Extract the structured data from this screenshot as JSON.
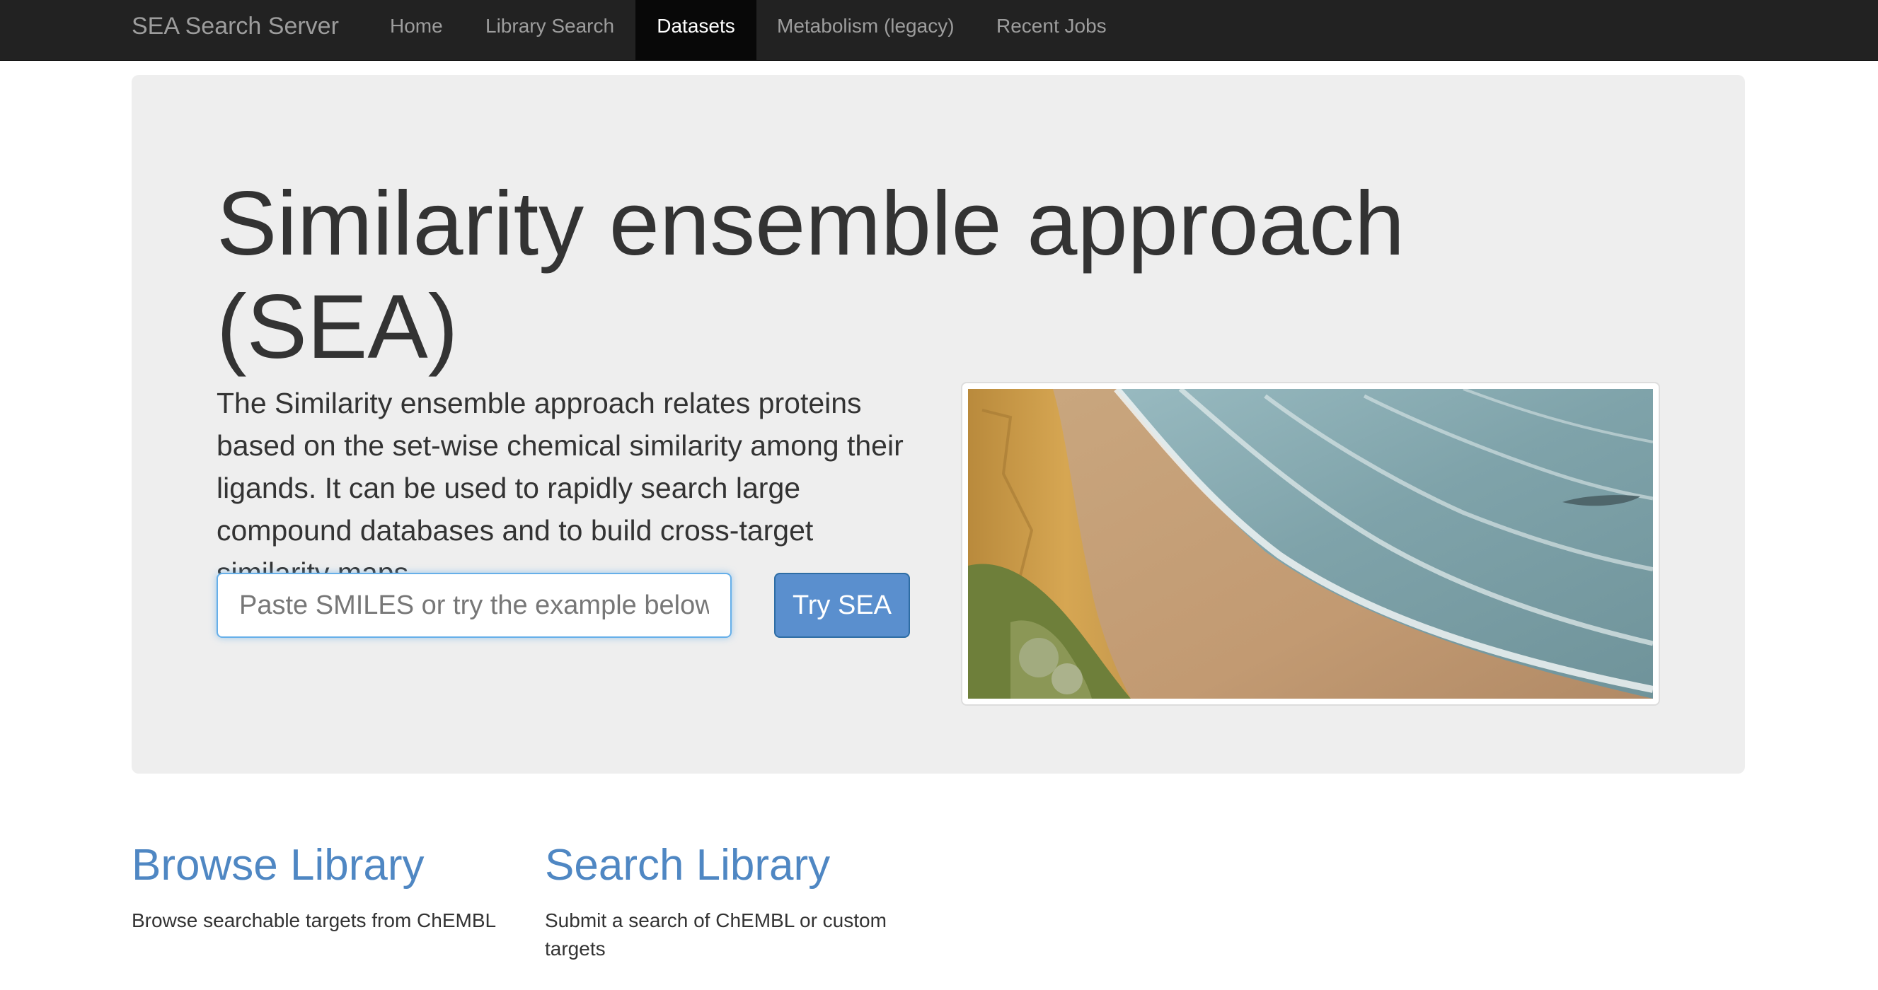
{
  "navbar": {
    "brand": "SEA Search Server",
    "items": [
      {
        "label": "Home"
      },
      {
        "label": "Library Search"
      },
      {
        "label": "Datasets",
        "active": true
      },
      {
        "label": "Metabolism (legacy)"
      },
      {
        "label": "Recent Jobs"
      }
    ]
  },
  "jumbotron": {
    "title": "Similarity ensemble approach (SEA)",
    "lead": "The Similarity ensemble approach relates proteins based on the set-wise chemical similarity among their ligands. It can be used to rapidly search large compound databases and to build cross-target similarity maps.",
    "input_placeholder": "Paste SMILES or try the example below",
    "input_value": "",
    "button_label": "Try SEA",
    "image_subject": "coastal cliff and beach"
  },
  "features": [
    {
      "title": "Browse Library",
      "description": "Browse searchable targets from ChEMBL"
    },
    {
      "title": "Search Library",
      "description": "Submit a search of ChEMBL or custom targets"
    }
  ],
  "colors": {
    "navbar_bg": "#222222",
    "nav_active_bg": "#080808",
    "jumbotron_bg": "#eeeeee",
    "link": "#4f87c3",
    "primary_button": "#5a8fce"
  }
}
